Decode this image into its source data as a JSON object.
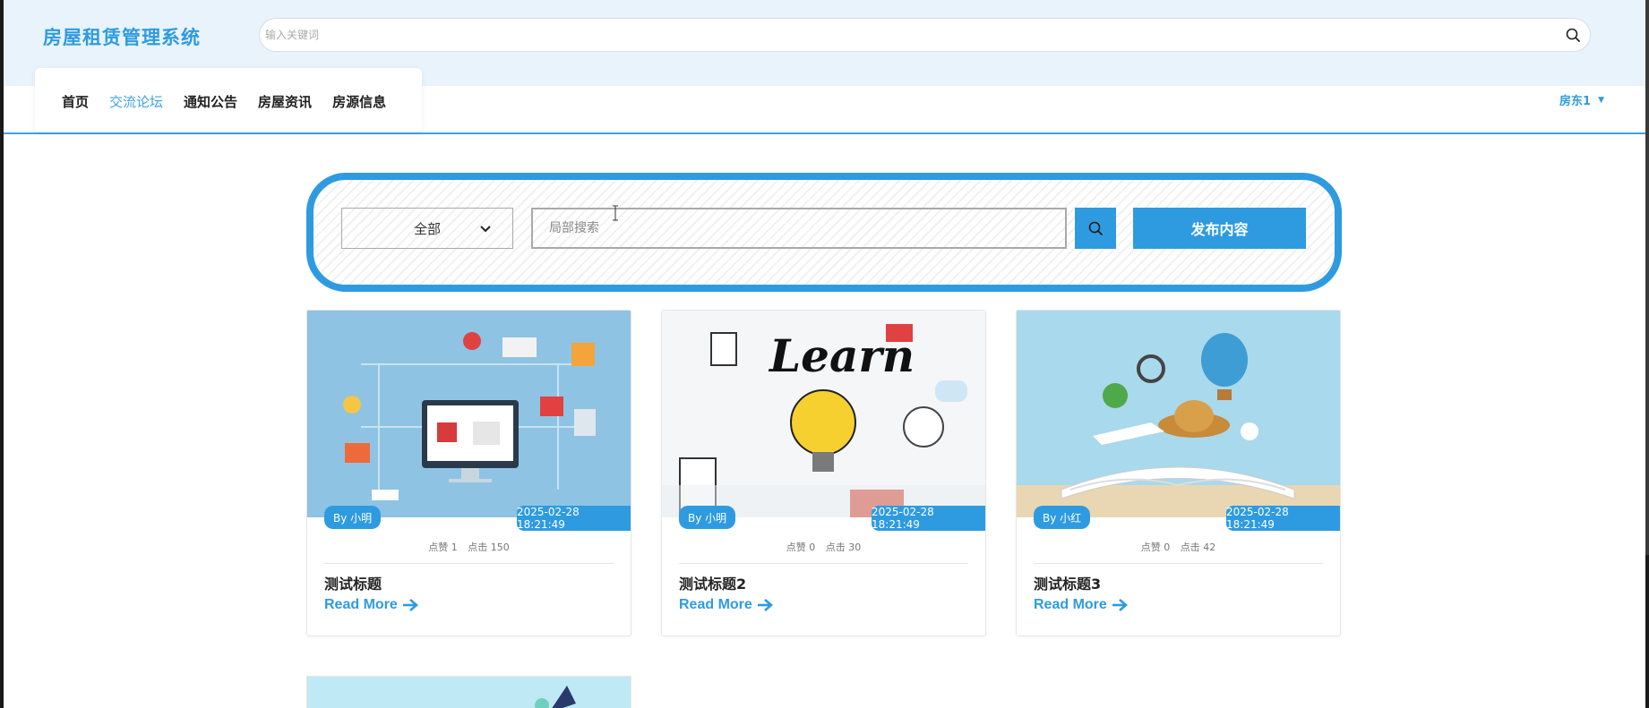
{
  "header": {
    "brand": "房屋租赁管理系统",
    "search_placeholder": "输入关键词"
  },
  "nav": {
    "items": [
      {
        "label": "首页",
        "active": false
      },
      {
        "label": "交流论坛",
        "active": true
      },
      {
        "label": "通知公告",
        "active": false
      },
      {
        "label": "房屋资讯",
        "active": false
      },
      {
        "label": "房源信息",
        "active": false
      }
    ],
    "user": "房东1"
  },
  "filter": {
    "category_selected": "全部",
    "local_search_placeholder": "局部搜索",
    "publish_label": "发布内容"
  },
  "cards": [
    {
      "author": "By 小明",
      "date": "2025-02-28 18:21:49",
      "likes": "点赞 1",
      "clicks": "点击 150",
      "title": "测试标题",
      "read_more": "Read More"
    },
    {
      "author": "By 小明",
      "date": "2025-02-28 18:21:49",
      "likes": "点赞 0",
      "clicks": "点击 30",
      "title": "测试标题2",
      "read_more": "Read More"
    },
    {
      "author": "By 小红",
      "date": "2025-02-28 18:21:49",
      "likes": "点赞 0",
      "clicks": "点击 42",
      "title": "测试标题3",
      "read_more": "Read More"
    }
  ],
  "colors": {
    "accent": "#2e9be0",
    "header_bg": "#e9f3fc"
  }
}
